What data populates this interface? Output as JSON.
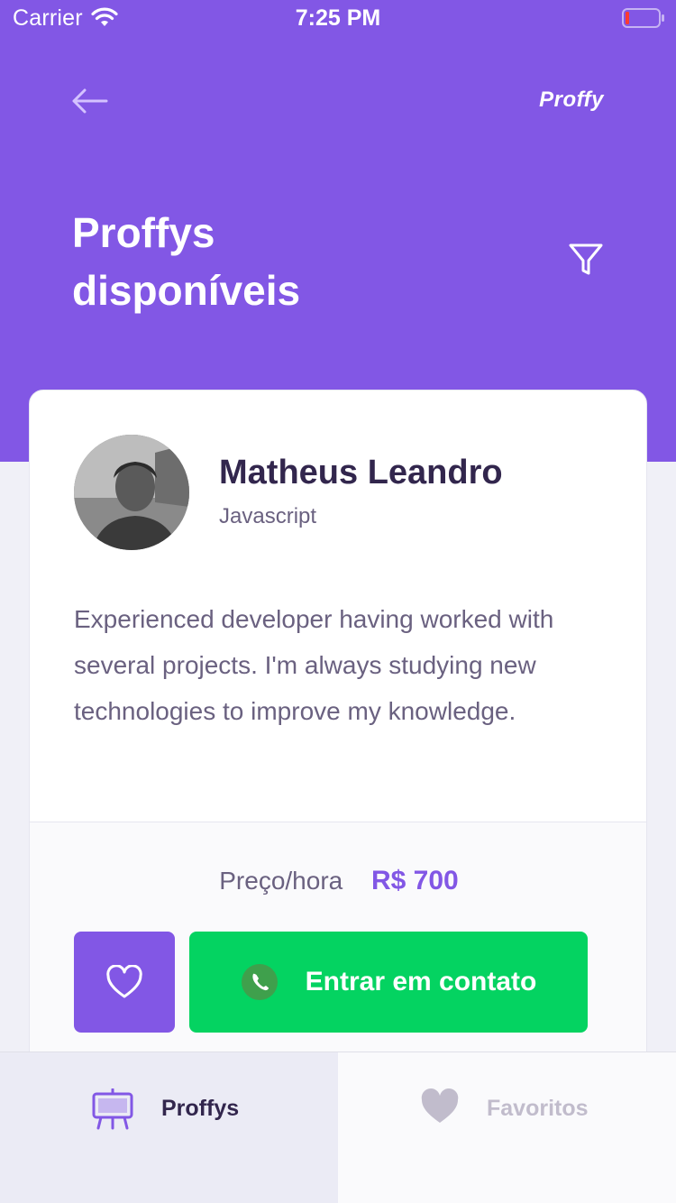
{
  "status_bar": {
    "carrier": "Carrier",
    "time": "7:25 PM"
  },
  "header": {
    "back_icon": "arrow-left-icon",
    "brand": "Proffy",
    "title_line1": "Proffys",
    "title_line2": "disponíveis",
    "filter_icon": "filter-icon",
    "background_color": "#8257E5"
  },
  "teacher_card": {
    "name": "Matheus Leandro",
    "subject": "Javascript",
    "bio": "Experienced developer having worked with several projects. I'm always studying new technologies to improve my knowledge.",
    "price_label": "Preço/hora",
    "price_value": "R$ 700",
    "favorite_icon": "heart-outline-icon",
    "contact_icon": "whatsapp-icon",
    "contact_label": "Entrar em contato",
    "favorite_button_color": "#8257E5",
    "contact_button_color": "#04D361"
  },
  "tab_bar": {
    "tabs": [
      {
        "label": "Proffys",
        "icon": "easel-icon",
        "active": true
      },
      {
        "label": "Favoritos",
        "icon": "heart-icon",
        "active": false
      }
    ]
  }
}
